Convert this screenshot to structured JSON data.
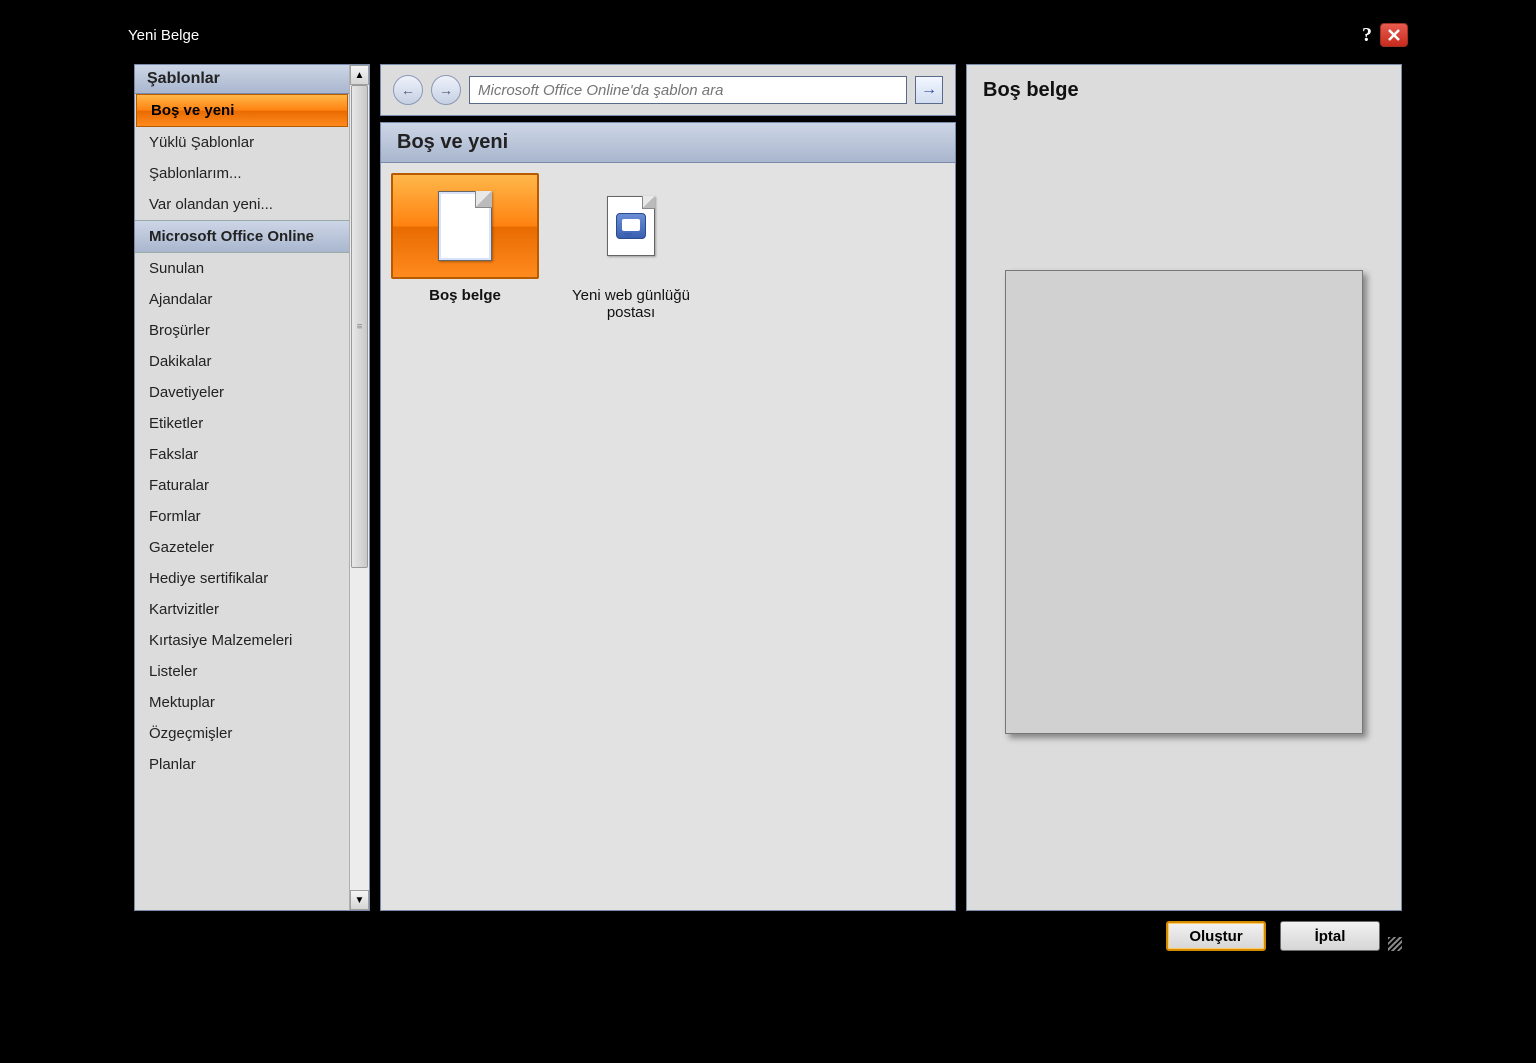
{
  "window": {
    "title": "Yeni Belge"
  },
  "sidebar": {
    "header": "Şablonlar",
    "items": [
      {
        "label": "Boş ve yeni",
        "selected": true
      },
      {
        "label": "Yüklü Şablonlar"
      },
      {
        "label": "Şablonlarım..."
      },
      {
        "label": "Var olandan yeni..."
      },
      {
        "label": "Microsoft Office Online",
        "section": true
      },
      {
        "label": "Sunulan"
      },
      {
        "label": "Ajandalar"
      },
      {
        "label": "Broşürler"
      },
      {
        "label": "Dakikalar"
      },
      {
        "label": "Davetiyeler"
      },
      {
        "label": "Etiketler"
      },
      {
        "label": "Fakslar"
      },
      {
        "label": "Faturalar"
      },
      {
        "label": "Formlar"
      },
      {
        "label": "Gazeteler"
      },
      {
        "label": "Hediye sertifikalar"
      },
      {
        "label": "Kartvizitler"
      },
      {
        "label": "Kırtasiye Malzemeleri"
      },
      {
        "label": "Listeler"
      },
      {
        "label": "Mektuplar"
      },
      {
        "label": "Özgeçmişler"
      },
      {
        "label": "Planlar"
      }
    ]
  },
  "search": {
    "placeholder": "Microsoft Office Online'da şablon ara"
  },
  "content": {
    "heading": "Boş ve yeni",
    "templates": [
      {
        "key": "blank-doc",
        "label": "Boş belge",
        "selected": true
      },
      {
        "key": "blog-post",
        "label": "Yeni web günlüğü postası",
        "selected": false
      }
    ]
  },
  "preview": {
    "title": "Boş belge"
  },
  "footer": {
    "create": "Oluştur",
    "cancel": "İptal"
  }
}
